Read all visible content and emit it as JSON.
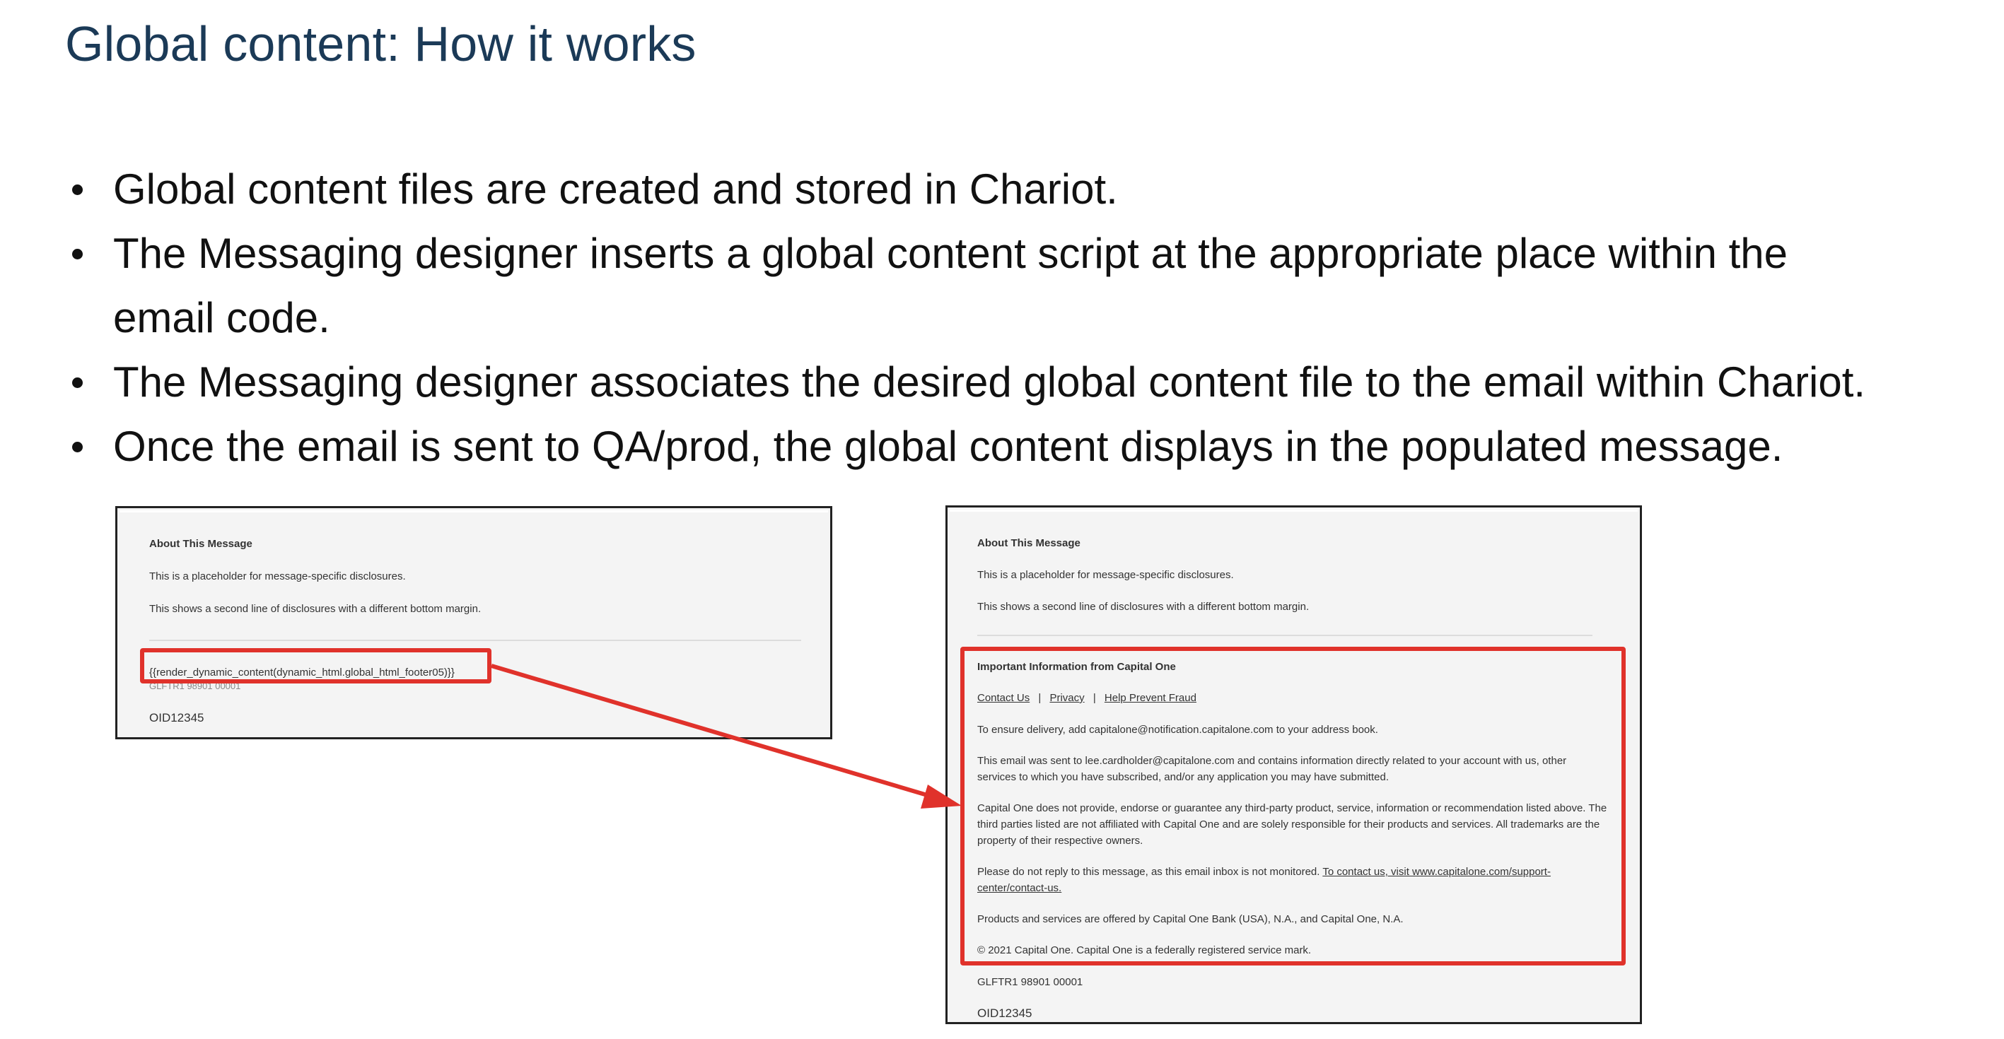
{
  "title": "Global content: How it works",
  "bullets": [
    "Global content files are created and stored in Chariot.",
    "The Messaging designer inserts a global content script at the appropriate place within the",
    "email code.",
    "The Messaging designer associates the desired global content file to the email within Chariot.",
    "Once the email is sent to QA/prod, the global content displays in the populated message."
  ],
  "left_shot": {
    "heading": "About This Message",
    "line1": "This is a placeholder for message-specific disclosures.",
    "line2": "This shows a second line of disclosures with a different bottom margin.",
    "script": "{{render_dynamic_content(dynamic_html.global_html_footer05)}}",
    "hidden_code": "GLFTR1 98901 00001",
    "oid": "OID12345"
  },
  "right_shot": {
    "heading": "About This Message",
    "line1": "This is a placeholder for message-specific disclosures.",
    "line2": "This shows a second line of disclosures with a different bottom margin.",
    "important_heading": "Important Information from Capital One",
    "links": [
      "Contact Us",
      "Privacy",
      "Help Prevent Fraud"
    ],
    "separator": "|",
    "delivery": "To ensure delivery, add capitalone@notification.capitalone.com to your address book.",
    "sent_to_1": "This email was sent to lee.cardholder@capitalone.com and contains information directly related to your account with us, other",
    "sent_to_2": "services to which you have subscribed, and/or any application you may have submitted.",
    "third_party_1": "Capital One does not provide, endorse or guarantee any third-party product, service, information or recommendation listed above. The",
    "third_party_2": "third parties listed are not affiliated with Capital One and are solely responsible for their products and services. All trademarks are the",
    "third_party_3": "property of their respective owners.",
    "noreply_1": "Please do not reply to this message, as this email inbox is not monitored. ",
    "noreply_link_1": "To contact us, visit www.capitalone.com/support-",
    "noreply_link_2": "center/contact-us.",
    "products": "Products and services are offered by Capital One Bank (USA), N.A., and Capital One, N.A.",
    "copyright": "© 2021 Capital One. Capital One is a federally registered service mark.",
    "code": "GLFTR1 98901 00001",
    "oid": "OID12345"
  },
  "colors": {
    "title": "#1b3a57",
    "highlight": "#e0322b",
    "panel_bg": "#f4f4f4"
  }
}
